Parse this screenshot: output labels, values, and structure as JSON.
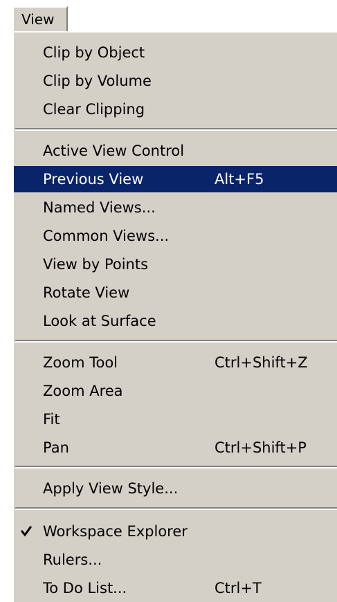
{
  "menubar": {
    "title": "View"
  },
  "colors": {
    "menu_background": "#d4d0c8",
    "highlight_background": "#0a246a",
    "highlight_text": "#ffffff"
  },
  "menu": {
    "groups": [
      {
        "items": [
          {
            "label": "Clip by Object",
            "shortcut": ""
          },
          {
            "label": "Clip by Volume",
            "shortcut": ""
          },
          {
            "label": "Clear Clipping",
            "shortcut": ""
          }
        ]
      },
      {
        "items": [
          {
            "label": "Active View Control",
            "shortcut": ""
          },
          {
            "label": "Previous View",
            "shortcut": "Alt+F5",
            "highlighted": true
          },
          {
            "label": "Named Views...",
            "shortcut": ""
          },
          {
            "label": "Common Views...",
            "shortcut": ""
          },
          {
            "label": "View by Points",
            "shortcut": ""
          },
          {
            "label": "Rotate View",
            "shortcut": ""
          },
          {
            "label": "Look at Surface",
            "shortcut": ""
          }
        ]
      },
      {
        "items": [
          {
            "label": "Zoom Tool",
            "shortcut": "Ctrl+Shift+Z"
          },
          {
            "label": "Zoom Area",
            "shortcut": ""
          },
          {
            "label": "Fit",
            "shortcut": ""
          },
          {
            "label": "Pan",
            "shortcut": "Ctrl+Shift+P"
          }
        ]
      },
      {
        "items": [
          {
            "label": "Apply View Style...",
            "shortcut": ""
          }
        ]
      },
      {
        "items": [
          {
            "label": "Workspace Explorer",
            "shortcut": "",
            "checked": true,
            "check_icon": "checkmark-icon"
          },
          {
            "label": "Rulers...",
            "shortcut": ""
          },
          {
            "label": "To Do List...",
            "shortcut": "Ctrl+T"
          }
        ]
      }
    ]
  }
}
